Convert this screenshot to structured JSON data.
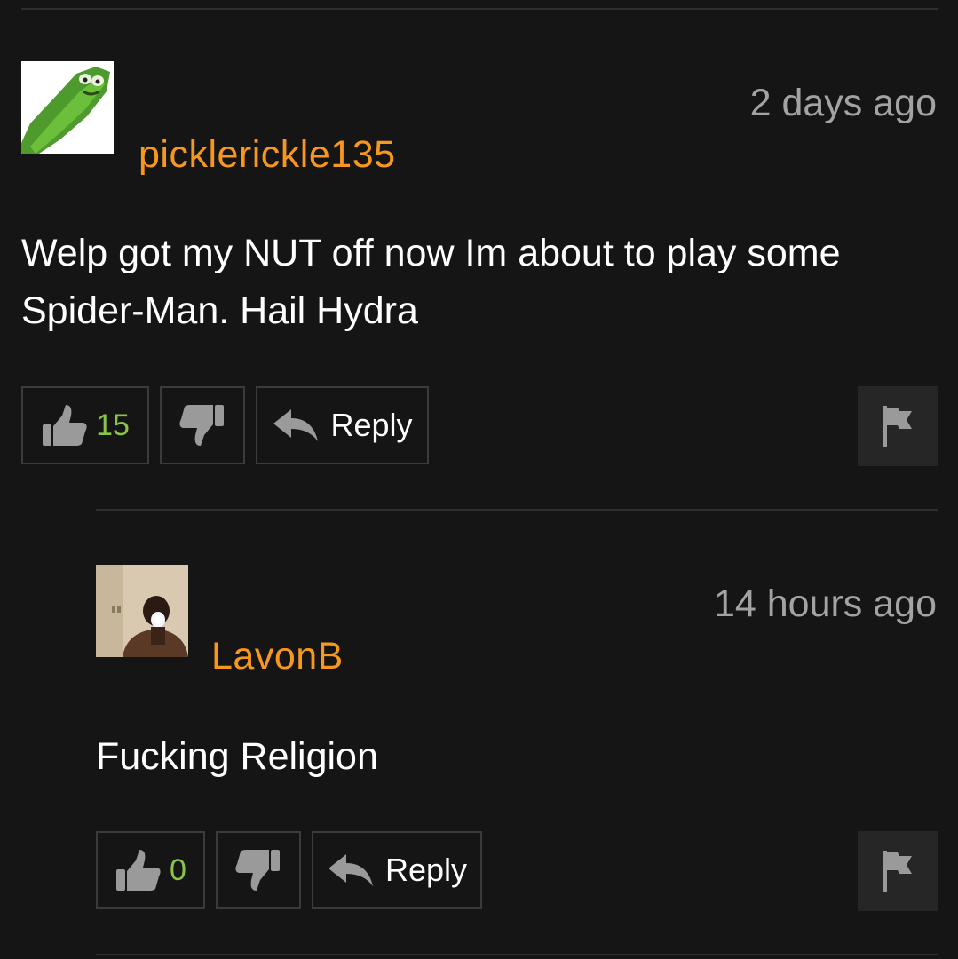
{
  "comments": [
    {
      "username": "picklerickle135",
      "timestamp": "2 days ago",
      "text_line1": "Welp got my NUT off now Im about to play some",
      "text_line2": "Spider-Man. Hail Hydra",
      "likes": "15",
      "reply_label": "Reply"
    },
    {
      "username": "LavonB",
      "timestamp": "14 hours ago",
      "text_line1": "Fucking Religion",
      "likes": "0",
      "reply_label": "Reply"
    }
  ],
  "colors": {
    "background": "#151515",
    "username": "#f7971d",
    "like_count": "#8bc34a",
    "timestamp": "#a3a3a3"
  },
  "icons": [
    "thumbs-up-icon",
    "thumbs-down-icon",
    "reply-arrow-icon",
    "flag-icon"
  ]
}
